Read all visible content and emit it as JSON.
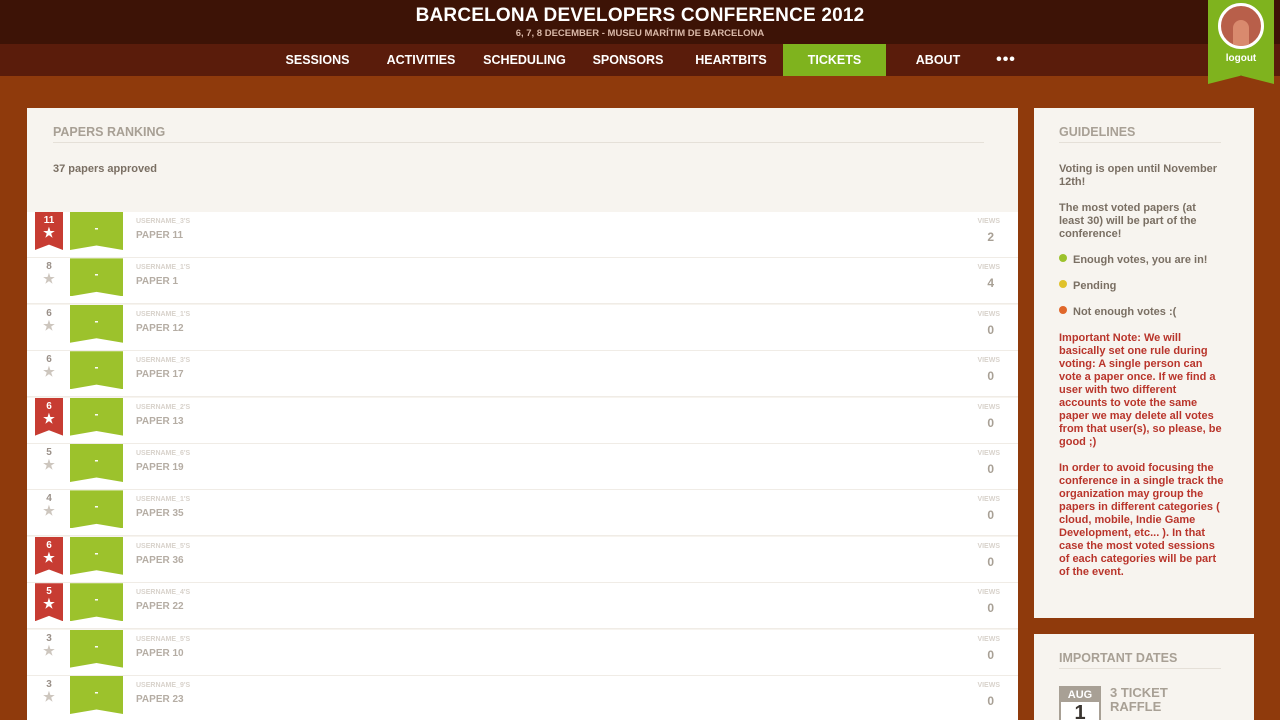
{
  "header": {
    "title": "BARCELONA DEVELOPERS CONFERENCE 2012",
    "subtitle": "6, 7, 8 DECEMBER - MUSEU MARÍTIM DE BARCELONA"
  },
  "nav": {
    "items": [
      {
        "label": "SESSIONS"
      },
      {
        "label": "ACTIVITIES"
      },
      {
        "label": "SCHEDULING"
      },
      {
        "label": "SPONSORS"
      },
      {
        "label": "HEARTBITS"
      },
      {
        "label": "TICKETS"
      },
      {
        "label": "ABOUT"
      }
    ],
    "more_label": "•••",
    "active": "TICKETS",
    "accent_color": "#7fb31e"
  },
  "user": {
    "logout_label": "logout",
    "avatar_icon": "user-avatar"
  },
  "ranking": {
    "title": "PAPERS RANKING",
    "approved_text": "37 papers approved",
    "views_label": "VIEWS",
    "ribbon_label": "-",
    "papers": [
      {
        "votes": "11",
        "hot": true,
        "username": "USERNAME_3'S",
        "title": "PAPER 11",
        "views": "2"
      },
      {
        "votes": "8",
        "hot": false,
        "username": "USERNAME_1'S",
        "title": "PAPER 1",
        "views": "4"
      },
      {
        "votes": "6",
        "hot": false,
        "username": "USERNAME_1'S",
        "title": "PAPER 12",
        "views": "0"
      },
      {
        "votes": "6",
        "hot": false,
        "username": "USERNAME_3'S",
        "title": "PAPER 17",
        "views": "0"
      },
      {
        "votes": "6",
        "hot": true,
        "username": "USERNAME_2'S",
        "title": "PAPER 13",
        "views": "0"
      },
      {
        "votes": "5",
        "hot": false,
        "username": "USERNAME_6'S",
        "title": "PAPER 19",
        "views": "0"
      },
      {
        "votes": "4",
        "hot": false,
        "username": "USERNAME_1'S",
        "title": "PAPER 35",
        "views": "0"
      },
      {
        "votes": "6",
        "hot": true,
        "username": "USERNAME_5'S",
        "title": "PAPER 36",
        "views": "0"
      },
      {
        "votes": "5",
        "hot": true,
        "username": "USERNAME_4'S",
        "title": "PAPER 22",
        "views": "0"
      },
      {
        "votes": "3",
        "hot": false,
        "username": "USERNAME_5'S",
        "title": "PAPER 10",
        "views": "0"
      },
      {
        "votes": "3",
        "hot": false,
        "username": "USERNAME_9'S",
        "title": "PAPER 23",
        "views": "0"
      }
    ]
  },
  "guidelines": {
    "title": "GUIDELINES",
    "voting_open": "Voting is open until November 12th!",
    "most_voted": "The most voted papers (at least 30) will be part of the conference!",
    "legend": [
      {
        "label": "Enough votes, you are in!",
        "color": "#9cc22c"
      },
      {
        "label": "Pending",
        "color": "#e0c22a"
      },
      {
        "label": "Not enough votes :(",
        "color": "#e0672a"
      }
    ],
    "important_note": "Important Note: We will basically set one rule during voting: A single person can vote a paper once. If we find a user with two different accounts to vote the same paper we may delete all votes from that user(s), so please, be good ;)",
    "tracks_note": "In order to avoid focusing the conference in a single track the organization may group the papers in different categories ( cloud, mobile, Indie Game Development, etc... ). In that case the most voted sessions of each categories will be part of the event."
  },
  "important_dates": {
    "title": "IMPORTANT DATES",
    "items": [
      {
        "month": "AUG",
        "day": "1",
        "event": "3 TICKET RAFFLE"
      }
    ]
  }
}
